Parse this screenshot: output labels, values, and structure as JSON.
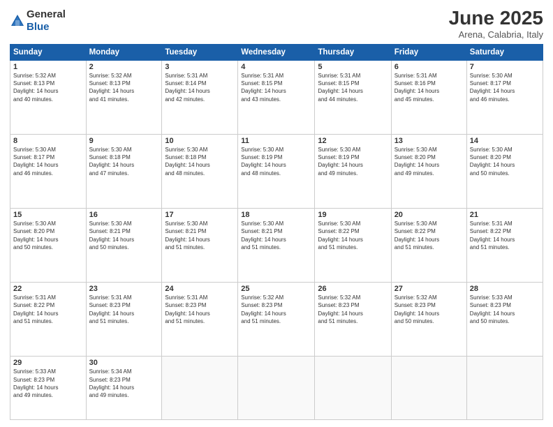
{
  "header": {
    "logo_general": "General",
    "logo_blue": "Blue",
    "month": "June 2025",
    "location": "Arena, Calabria, Italy"
  },
  "days_of_week": [
    "Sunday",
    "Monday",
    "Tuesday",
    "Wednesday",
    "Thursday",
    "Friday",
    "Saturday"
  ],
  "weeks": [
    [
      {
        "day": 1,
        "info": "Sunrise: 5:32 AM\nSunset: 8:13 PM\nDaylight: 14 hours\nand 40 minutes."
      },
      {
        "day": 2,
        "info": "Sunrise: 5:32 AM\nSunset: 8:13 PM\nDaylight: 14 hours\nand 41 minutes."
      },
      {
        "day": 3,
        "info": "Sunrise: 5:31 AM\nSunset: 8:14 PM\nDaylight: 14 hours\nand 42 minutes."
      },
      {
        "day": 4,
        "info": "Sunrise: 5:31 AM\nSunset: 8:15 PM\nDaylight: 14 hours\nand 43 minutes."
      },
      {
        "day": 5,
        "info": "Sunrise: 5:31 AM\nSunset: 8:15 PM\nDaylight: 14 hours\nand 44 minutes."
      },
      {
        "day": 6,
        "info": "Sunrise: 5:31 AM\nSunset: 8:16 PM\nDaylight: 14 hours\nand 45 minutes."
      },
      {
        "day": 7,
        "info": "Sunrise: 5:30 AM\nSunset: 8:17 PM\nDaylight: 14 hours\nand 46 minutes."
      }
    ],
    [
      {
        "day": 8,
        "info": "Sunrise: 5:30 AM\nSunset: 8:17 PM\nDaylight: 14 hours\nand 46 minutes."
      },
      {
        "day": 9,
        "info": "Sunrise: 5:30 AM\nSunset: 8:18 PM\nDaylight: 14 hours\nand 47 minutes."
      },
      {
        "day": 10,
        "info": "Sunrise: 5:30 AM\nSunset: 8:18 PM\nDaylight: 14 hours\nand 48 minutes."
      },
      {
        "day": 11,
        "info": "Sunrise: 5:30 AM\nSunset: 8:19 PM\nDaylight: 14 hours\nand 48 minutes."
      },
      {
        "day": 12,
        "info": "Sunrise: 5:30 AM\nSunset: 8:19 PM\nDaylight: 14 hours\nand 49 minutes."
      },
      {
        "day": 13,
        "info": "Sunrise: 5:30 AM\nSunset: 8:20 PM\nDaylight: 14 hours\nand 49 minutes."
      },
      {
        "day": 14,
        "info": "Sunrise: 5:30 AM\nSunset: 8:20 PM\nDaylight: 14 hours\nand 50 minutes."
      }
    ],
    [
      {
        "day": 15,
        "info": "Sunrise: 5:30 AM\nSunset: 8:20 PM\nDaylight: 14 hours\nand 50 minutes."
      },
      {
        "day": 16,
        "info": "Sunrise: 5:30 AM\nSunset: 8:21 PM\nDaylight: 14 hours\nand 50 minutes."
      },
      {
        "day": 17,
        "info": "Sunrise: 5:30 AM\nSunset: 8:21 PM\nDaylight: 14 hours\nand 51 minutes."
      },
      {
        "day": 18,
        "info": "Sunrise: 5:30 AM\nSunset: 8:21 PM\nDaylight: 14 hours\nand 51 minutes."
      },
      {
        "day": 19,
        "info": "Sunrise: 5:30 AM\nSunset: 8:22 PM\nDaylight: 14 hours\nand 51 minutes."
      },
      {
        "day": 20,
        "info": "Sunrise: 5:30 AM\nSunset: 8:22 PM\nDaylight: 14 hours\nand 51 minutes."
      },
      {
        "day": 21,
        "info": "Sunrise: 5:31 AM\nSunset: 8:22 PM\nDaylight: 14 hours\nand 51 minutes."
      }
    ],
    [
      {
        "day": 22,
        "info": "Sunrise: 5:31 AM\nSunset: 8:22 PM\nDaylight: 14 hours\nand 51 minutes."
      },
      {
        "day": 23,
        "info": "Sunrise: 5:31 AM\nSunset: 8:23 PM\nDaylight: 14 hours\nand 51 minutes."
      },
      {
        "day": 24,
        "info": "Sunrise: 5:31 AM\nSunset: 8:23 PM\nDaylight: 14 hours\nand 51 minutes."
      },
      {
        "day": 25,
        "info": "Sunrise: 5:32 AM\nSunset: 8:23 PM\nDaylight: 14 hours\nand 51 minutes."
      },
      {
        "day": 26,
        "info": "Sunrise: 5:32 AM\nSunset: 8:23 PM\nDaylight: 14 hours\nand 51 minutes."
      },
      {
        "day": 27,
        "info": "Sunrise: 5:32 AM\nSunset: 8:23 PM\nDaylight: 14 hours\nand 50 minutes."
      },
      {
        "day": 28,
        "info": "Sunrise: 5:33 AM\nSunset: 8:23 PM\nDaylight: 14 hours\nand 50 minutes."
      }
    ],
    [
      {
        "day": 29,
        "info": "Sunrise: 5:33 AM\nSunset: 8:23 PM\nDaylight: 14 hours\nand 49 minutes."
      },
      {
        "day": 30,
        "info": "Sunrise: 5:34 AM\nSunset: 8:23 PM\nDaylight: 14 hours\nand 49 minutes."
      },
      null,
      null,
      null,
      null,
      null
    ]
  ]
}
